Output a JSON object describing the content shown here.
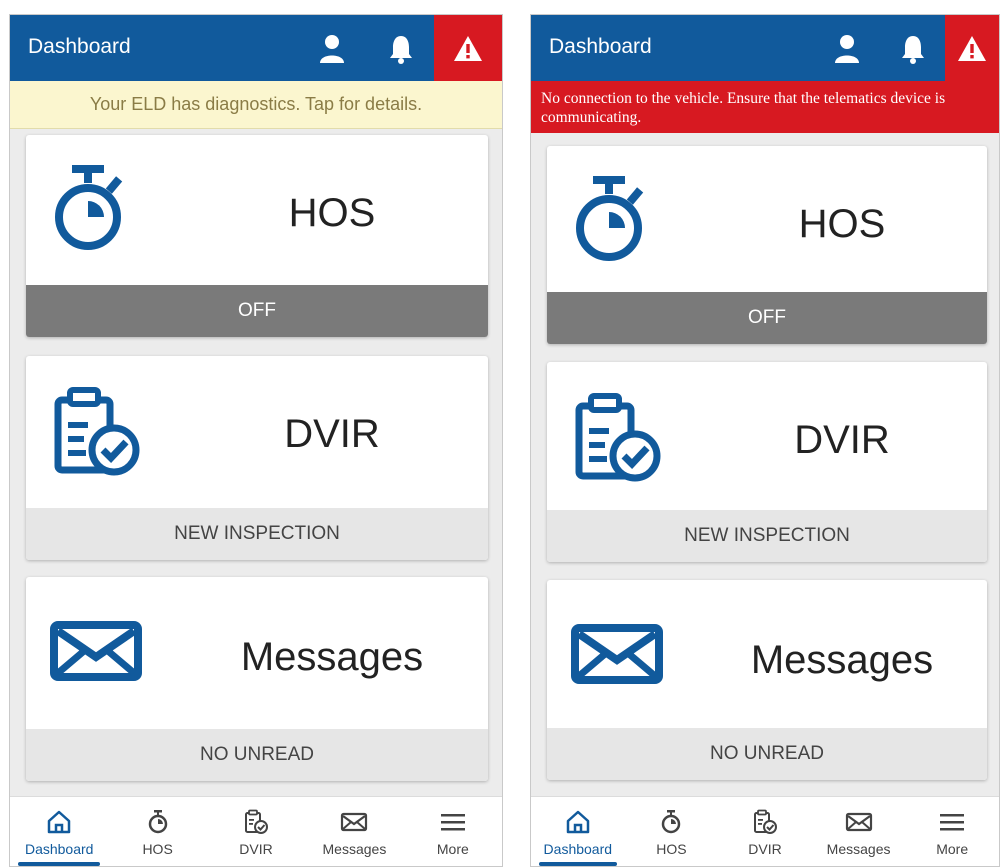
{
  "colors": {
    "primary": "#115a9c",
    "alert_red": "#d71921",
    "diagnostic_banner_bg": "#fbf6cf",
    "status_off_gray": "#7a7a7a"
  },
  "screens": [
    {
      "appbar": {
        "title": "Dashboard",
        "icons": [
          "user-icon",
          "bell-icon",
          "warning-icon"
        ]
      },
      "banner": {
        "type": "diagnostic",
        "text": "Your ELD has diagnostics. Tap for details."
      },
      "cards": [
        {
          "icon": "stopwatch-icon",
          "title": "HOS",
          "footer": "OFF"
        },
        {
          "icon": "clipboard-check-icon",
          "title": "DVIR",
          "footer": "NEW INSPECTION"
        },
        {
          "icon": "envelope-icon",
          "title": "Messages",
          "footer": "NO UNREAD"
        }
      ],
      "tabs": [
        {
          "icon": "home-icon",
          "label": "Dashboard",
          "active": true
        },
        {
          "icon": "stopwatch-icon",
          "label": "HOS"
        },
        {
          "icon": "clipboard-check-icon",
          "label": "DVIR"
        },
        {
          "icon": "envelope-icon",
          "label": "Messages"
        },
        {
          "icon": "menu-icon",
          "label": "More"
        }
      ]
    },
    {
      "appbar": {
        "title": "Dashboard",
        "icons": [
          "user-icon",
          "bell-icon",
          "warning-icon"
        ]
      },
      "banner": {
        "type": "malfunction",
        "text": "No connection to the vehicle. Ensure that the telematics device is communicating."
      },
      "cards": [
        {
          "icon": "stopwatch-icon",
          "title": "HOS",
          "footer": "OFF"
        },
        {
          "icon": "clipboard-check-icon",
          "title": "DVIR",
          "footer": "NEW INSPECTION"
        },
        {
          "icon": "envelope-icon",
          "title": "Messages",
          "footer": "NO UNREAD"
        }
      ],
      "tabs": [
        {
          "icon": "home-icon",
          "label": "Dashboard",
          "active": true
        },
        {
          "icon": "stopwatch-icon",
          "label": "HOS"
        },
        {
          "icon": "clipboard-check-icon",
          "label": "DVIR"
        },
        {
          "icon": "envelope-icon",
          "label": "Messages"
        },
        {
          "icon": "menu-icon",
          "label": "More"
        }
      ]
    }
  ]
}
